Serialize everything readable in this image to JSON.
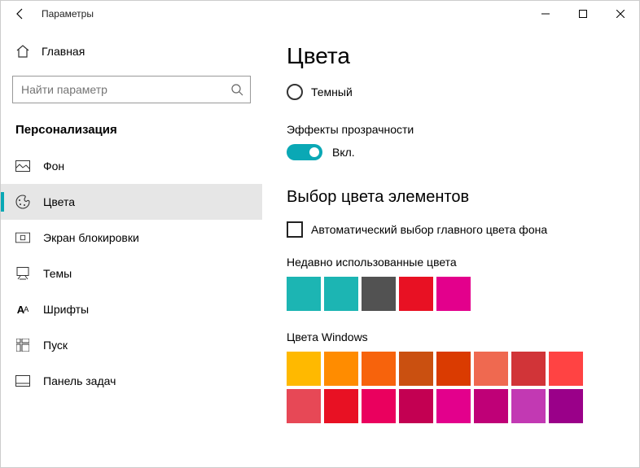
{
  "window": {
    "title": "Параметры"
  },
  "sidebar": {
    "home_label": "Главная",
    "search_placeholder": "Найти параметр",
    "category": "Персонализация",
    "items": [
      {
        "label": "Фон"
      },
      {
        "label": "Цвета"
      },
      {
        "label": "Экран блокировки"
      },
      {
        "label": "Темы"
      },
      {
        "label": "Шрифты"
      },
      {
        "label": "Пуск"
      },
      {
        "label": "Панель задач"
      }
    ]
  },
  "main": {
    "page_title": "Цвета",
    "dark_option": "Темный",
    "transparency_label": "Эффекты прозрачности",
    "toggle_state": "Вкл.",
    "accent_section": "Выбор цвета элементов",
    "auto_accent_label": "Автоматический выбор главного цвета фона",
    "recent_label": "Недавно использованные цвета",
    "recent_colors": [
      "#1cb5b3",
      "#1cb5b3",
      "#525252",
      "#e81123",
      "#e3008c"
    ],
    "windows_colors_label": "Цвета Windows",
    "windows_colors_row1": [
      "#ffb900",
      "#ff8c00",
      "#f7630c",
      "#ca5010",
      "#da3b01",
      "#ef6950",
      "#d13438",
      "#ff4343"
    ],
    "windows_colors_row2": [
      "#e74856",
      "#e81123",
      "#ea005e",
      "#c30052",
      "#e3008c",
      "#bf0077",
      "#c239b3",
      "#9a0089"
    ]
  }
}
